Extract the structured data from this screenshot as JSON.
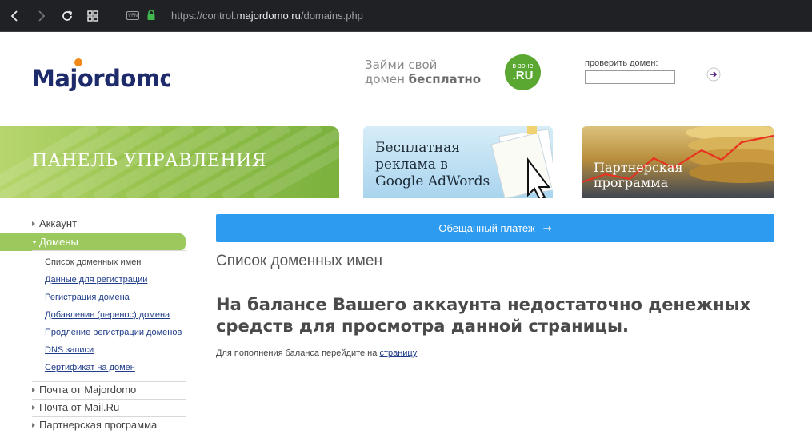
{
  "browser": {
    "url_prefix": "https://control.",
    "url_domain": "majordomo.ru",
    "url_path": "/domains.php",
    "vpn_label": "VPN"
  },
  "header": {
    "logo_text": "Majordomo",
    "promo_line1": "Займи свой",
    "promo_line2_a": "домен ",
    "promo_line2_b": "бесплатно",
    "zone_line1": "в зоне",
    "zone_line2": ".RU",
    "check_label": "проверить домен:",
    "check_placeholder": ""
  },
  "banners": {
    "panel_title": "ПАНЕЛЬ УПРАВЛЕНИЯ",
    "ad_line1": "Бесплатная",
    "ad_line2": "реклама в",
    "ad_line3": "Google AdWords",
    "partner_line1": "Партнерская",
    "partner_line2": "программа"
  },
  "sidebar": {
    "account": "Аккаунт",
    "domains": "Домены",
    "sub_items": [
      "Список доменных имен",
      "Данные для регистрации",
      "Регистрация домена",
      "Добавление (перенос) домена",
      "Продление регистрации доменов",
      "DNS записи",
      "Сертификат на домен"
    ],
    "mail_majordomo": "Почта от Majordomo",
    "mail_mailru": "Почта от Mail.Ru",
    "partner": "Партнерская программа"
  },
  "main": {
    "pay_button": "Обещанный платеж",
    "pay_arrow": "→",
    "title": "Список доменных имен",
    "warning_line1": "На балансе Вашего аккаунта недостаточно денежных",
    "warning_line2": "средств для просмотра данной страницы.",
    "hint_text": "Для пополнения баланса перейдите на ",
    "hint_link": "страницу"
  },
  "colors": {
    "accent_green": "#9bc95d",
    "button_blue": "#2d9bf0",
    "logo_navy": "#1d2b6b",
    "logo_orange": "#f08a1c"
  }
}
